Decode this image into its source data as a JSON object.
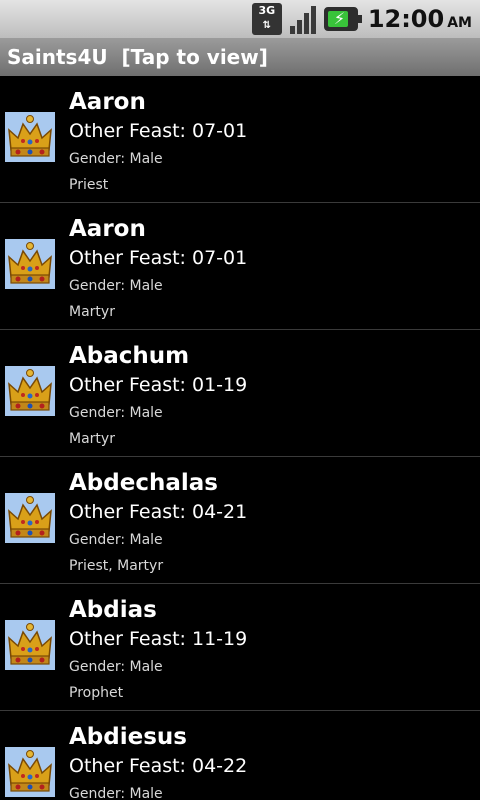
{
  "status": {
    "network": "3G",
    "time": "12:00",
    "ampm": "AM"
  },
  "app": {
    "title": "Saints4U  [Tap to view]"
  },
  "saints": [
    {
      "name": "Aaron",
      "feast": "Other Feast: 07-01",
      "gender": "Gender: Male",
      "type": "Priest"
    },
    {
      "name": "Aaron",
      "feast": "Other Feast: 07-01",
      "gender": "Gender: Male",
      "type": "Martyr"
    },
    {
      "name": "Abachum",
      "feast": "Other Feast: 01-19",
      "gender": "Gender: Male",
      "type": "Martyr"
    },
    {
      "name": "Abdechalas",
      "feast": "Other Feast: 04-21",
      "gender": "Gender: Male",
      "type": "Priest, Martyr"
    },
    {
      "name": "Abdias",
      "feast": "Other Feast: 11-19",
      "gender": "Gender: Male",
      "type": "Prophet"
    },
    {
      "name": "Abdiesus",
      "feast": "Other Feast: 04-22",
      "gender": "Gender: Male",
      "type": ""
    }
  ]
}
